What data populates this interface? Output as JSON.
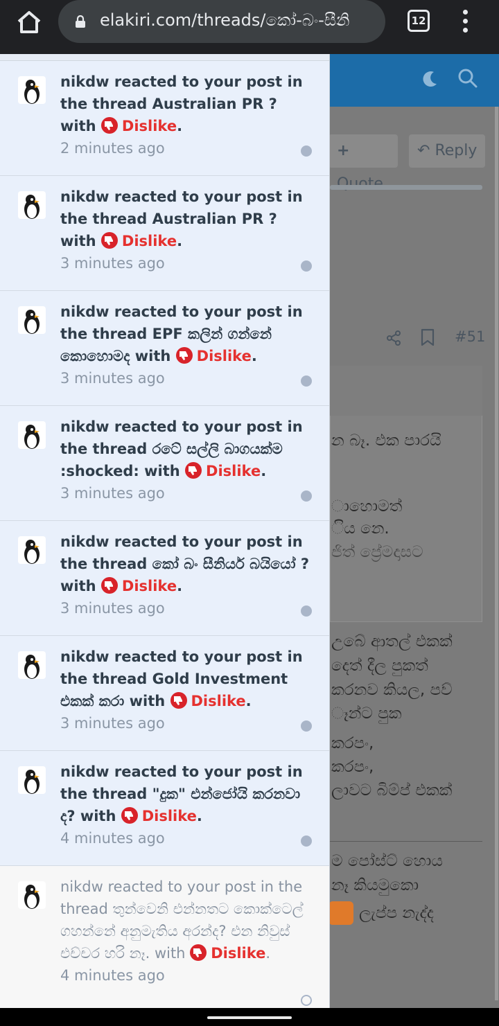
{
  "browser": {
    "url": "elakiri.com/threads/කෝ-බං-සීනි",
    "tab_count": "12"
  },
  "page": {
    "quote_label": "Quote",
    "reply_label": "Reply",
    "post_number": "#51",
    "text_lines": [
      "න බෑ. එක පාරයි",
      "ාහොමත්",
      "ිය නෙ.",
      "ජිත් ප්‍රේමදාසට",
      "උබේ ආතල් එකක්",
      "දෙත් දීල පුකත්",
      "කරනව කියල, පව්",
      "ෑන්ට පුක",
      "කරපං,",
      "කරපං,",
      "ලාවට බිම්ප් එකක්",
      "ම පෝස්ට් හොය",
      "නෑ කියමුකො",
      "ලැප්ප නැද්ද"
    ]
  },
  "notifications": [
    {
      "user": "nikdw",
      "prefix": "reacted to your post in the thread",
      "thread": "Australian PR ?",
      "with": "with",
      "reaction": "Dislike",
      "time": "2 minutes ago",
      "unread": true
    },
    {
      "user": "nikdw",
      "prefix": "reacted to your post in the thread",
      "thread": "Australian PR ?",
      "with": "with",
      "reaction": "Dislike",
      "time": "3 minutes ago",
      "unread": true
    },
    {
      "user": "nikdw",
      "prefix": "reacted to your post in the thread",
      "thread": "EPF කලින් ගන්නේ කොහොමද",
      "with": "with",
      "reaction": "Dislike",
      "time": "3 minutes ago",
      "unread": true
    },
    {
      "user": "nikdw",
      "prefix": "reacted to your post in the thread",
      "thread": "රටේ සල්ලි බාගයක්ම :shocked:",
      "with": "with",
      "reaction": "Dislike",
      "time": "3 minutes ago",
      "unread": true
    },
    {
      "user": "nikdw",
      "prefix": "reacted to your post in the thread",
      "thread": "කෝ බං සීනියර් බයියෝ ?",
      "with": "with",
      "reaction": "Dislike",
      "time": "3 minutes ago",
      "unread": true
    },
    {
      "user": "nikdw",
      "prefix": "reacted to your post in the thread",
      "thread": "Gold Investment එකක් කරා",
      "with": "with",
      "reaction": "Dislike",
      "time": "3 minutes ago",
      "unread": true
    },
    {
      "user": "nikdw",
      "prefix": "reacted to your post in the thread",
      "thread": "\"දුක\" එන්ජෝයි කරනවා ද?",
      "with": "with",
      "reaction": "Dislike",
      "time": "4 minutes ago",
      "unread": true
    },
    {
      "user": "nikdw",
      "prefix": "reacted to your post in the thread",
      "thread": "තුන්වෙනි එන්නතට කොක්ටෙල් ගහන්නේ අනුමැතිය අරන්ද? එන නිවුස් එච්චර හරි නෑ.",
      "with": "with",
      "reaction": "Dislike",
      "time": "4 minutes ago",
      "unread": false
    }
  ],
  "colors": {
    "unread_bg": "#e9f0fb",
    "read_bg": "#f7f7f7",
    "dislike": "#e5312f",
    "header": "#1c6ca8"
  }
}
